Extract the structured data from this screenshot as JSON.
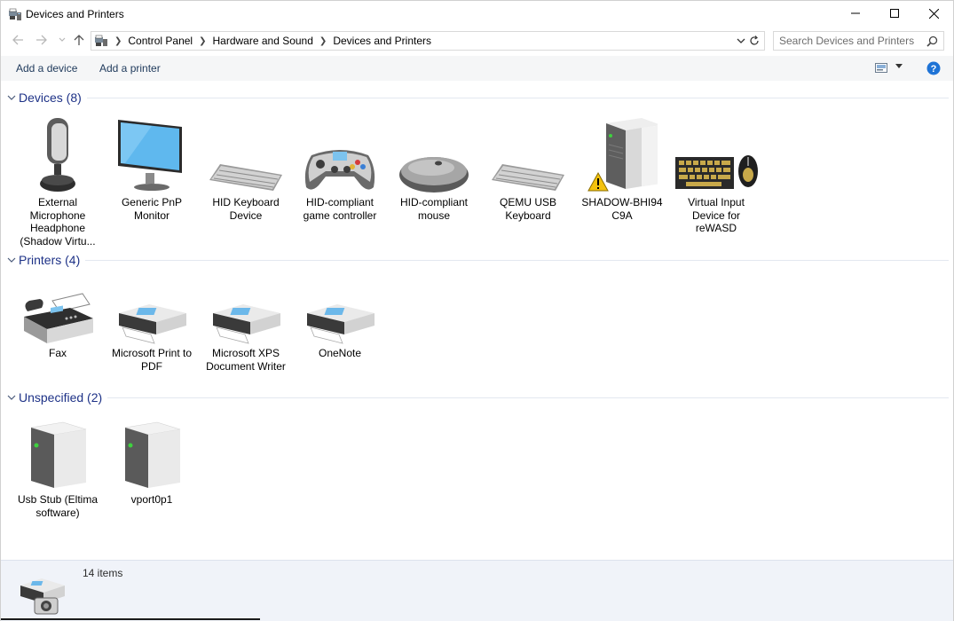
{
  "window": {
    "title": "Devices and Printers",
    "icon": "devices-printers-icon"
  },
  "address": {
    "breadcrumbs": [
      "Control Panel",
      "Hardware and Sound",
      "Devices and Printers"
    ],
    "search_placeholder": "Search Devices and Printers"
  },
  "toolbar": {
    "add_device": "Add a device",
    "add_printer": "Add a printer"
  },
  "groups": {
    "devices": {
      "title": "Devices (8)",
      "items": [
        {
          "label": "External Microphone Headphone (Shadow Virtu...",
          "icon": "microphone-icon"
        },
        {
          "label": "Generic PnP Monitor",
          "icon": "monitor-icon"
        },
        {
          "label": "HID Keyboard Device",
          "icon": "keyboard-icon"
        },
        {
          "label": "HID-compliant game controller",
          "icon": "gamepad-icon"
        },
        {
          "label": "HID-compliant mouse",
          "icon": "mouse-icon"
        },
        {
          "label": "QEMU USB Keyboard",
          "icon": "keyboard-icon"
        },
        {
          "label": "SHADOW-BHI94C9A",
          "icon": "computer-tower-warning-icon"
        },
        {
          "label": "Virtual Input Device for reWASD",
          "icon": "keyboard-mouse-icon"
        }
      ]
    },
    "printers": {
      "title": "Printers (4)",
      "items": [
        {
          "label": "Fax",
          "icon": "fax-icon"
        },
        {
          "label": "Microsoft Print to PDF",
          "icon": "printer-icon"
        },
        {
          "label": "Microsoft XPS Document Writer",
          "icon": "printer-icon"
        },
        {
          "label": "OneNote",
          "icon": "printer-icon"
        }
      ]
    },
    "unspecified": {
      "title": "Unspecified (2)",
      "items": [
        {
          "label": "Usb Stub (Eltima software)",
          "icon": "server-box-icon"
        },
        {
          "label": "vport0p1",
          "icon": "server-box-icon"
        }
      ]
    }
  },
  "status": {
    "count": "14 items"
  },
  "colors": {
    "group_title": "#1e3287",
    "command_text": "#1e395b",
    "status_bg": "#f0f3f9",
    "help_blue": "#1e73d6"
  }
}
